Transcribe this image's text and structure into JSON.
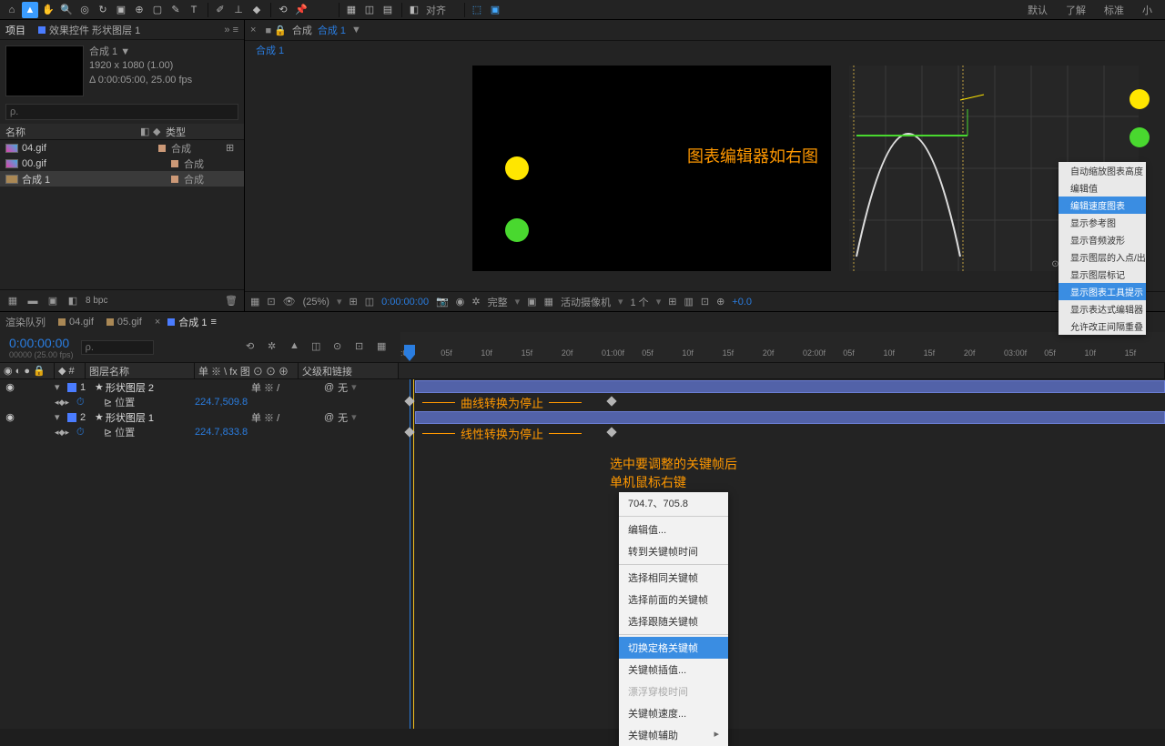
{
  "toolbar": {
    "workspaces": [
      "默认",
      "了解",
      "标准",
      "小"
    ]
  },
  "project": {
    "tab1": "项目",
    "tab2": "效果控件 形状图层 1",
    "comp_name": "合成 1 ▼",
    "resolution": "1920 x 1080 (1.00)",
    "duration": "Δ 0:00:05:00, 25.00 fps",
    "search_ph": "ρ.",
    "col_name": "名称",
    "col_type": "类型",
    "items": [
      {
        "name": "04.gif",
        "type": "合成"
      },
      {
        "name": "00.gif",
        "type": "合成"
      },
      {
        "name": "合成 1",
        "type": "合成"
      }
    ],
    "bpc": "8 bpc"
  },
  "comp": {
    "tab_main": "合成",
    "tab_link": "合成 1",
    "bar_name": "合成 1",
    "preview_label": "图表编辑器如右图"
  },
  "graph_menu": [
    "自动缩放图表高度",
    "编辑值",
    "编辑速度图表",
    "显示参考图",
    "显示音频波形",
    "显示图层的入点/出点",
    "显示图层标记",
    "显示图表工具提示",
    "显示表达式编辑器",
    "允许改正间隔重叠"
  ],
  "graph_menu_hl": [
    2,
    7
  ],
  "viewer_footer": {
    "zoom": "(25%)",
    "time": "0:00:00:00",
    "quality": "完整",
    "camera": "活动摄像机",
    "views": "1 个",
    "deg": "+0.0"
  },
  "timeline": {
    "tabs": [
      "渲染队列",
      "04.gif",
      "05.gif",
      "合成 1"
    ],
    "timecode": "0:00:00:00",
    "fps_label": "00000 (25.00 fps)",
    "search_ph": "ρ.",
    "col_layer": "图层名称",
    "col_mode": "单 ※ \\ fx 图 ⊙ ⊙ ⊕",
    "col_parent": "父级和链接",
    "ticks": [
      ":00f",
      "05f",
      "10f",
      "15f",
      "20f",
      "01:00f",
      "05f",
      "10f",
      "15f",
      "20f",
      "02:00f",
      "05f",
      "10f",
      "15f",
      "20f",
      "03:00f",
      "05f",
      "10f",
      "15f"
    ],
    "layers": [
      {
        "num": "1",
        "name": "形状图层 2",
        "mode": "单 ※ /",
        "parent": "无",
        "prop": "位置",
        "val": "224.7,509.8"
      },
      {
        "num": "2",
        "name": "形状图层 1",
        "mode": "单 ※ /",
        "parent": "无",
        "prop": "位置",
        "val": "224.7,833.8"
      }
    ],
    "anno1": "曲线转换为停止",
    "anno2": "线性转换为停止",
    "anno_text1": "选中要调整的关键帧后",
    "anno_text2": "单机鼠标右键"
  },
  "context_menu": {
    "value": "704.7、705.8",
    "items": [
      {
        "t": "编辑值...",
        "dis": false
      },
      {
        "t": "转到关键帧时间",
        "dis": false
      },
      {
        "sep": true
      },
      {
        "t": "选择相同关键帧",
        "dis": false
      },
      {
        "t": "选择前面的关键帧",
        "dis": false
      },
      {
        "t": "选择跟随关键帧",
        "dis": false
      },
      {
        "sep": true
      },
      {
        "t": "切换定格关键帧",
        "hl": true
      },
      {
        "t": "关键帧插值...",
        "dis": false
      },
      {
        "t": "漂浮穿梭时间",
        "dis": true
      },
      {
        "t": "关键帧速度...",
        "dis": false
      },
      {
        "t": "关键帧辅助",
        "arr": true
      }
    ]
  }
}
